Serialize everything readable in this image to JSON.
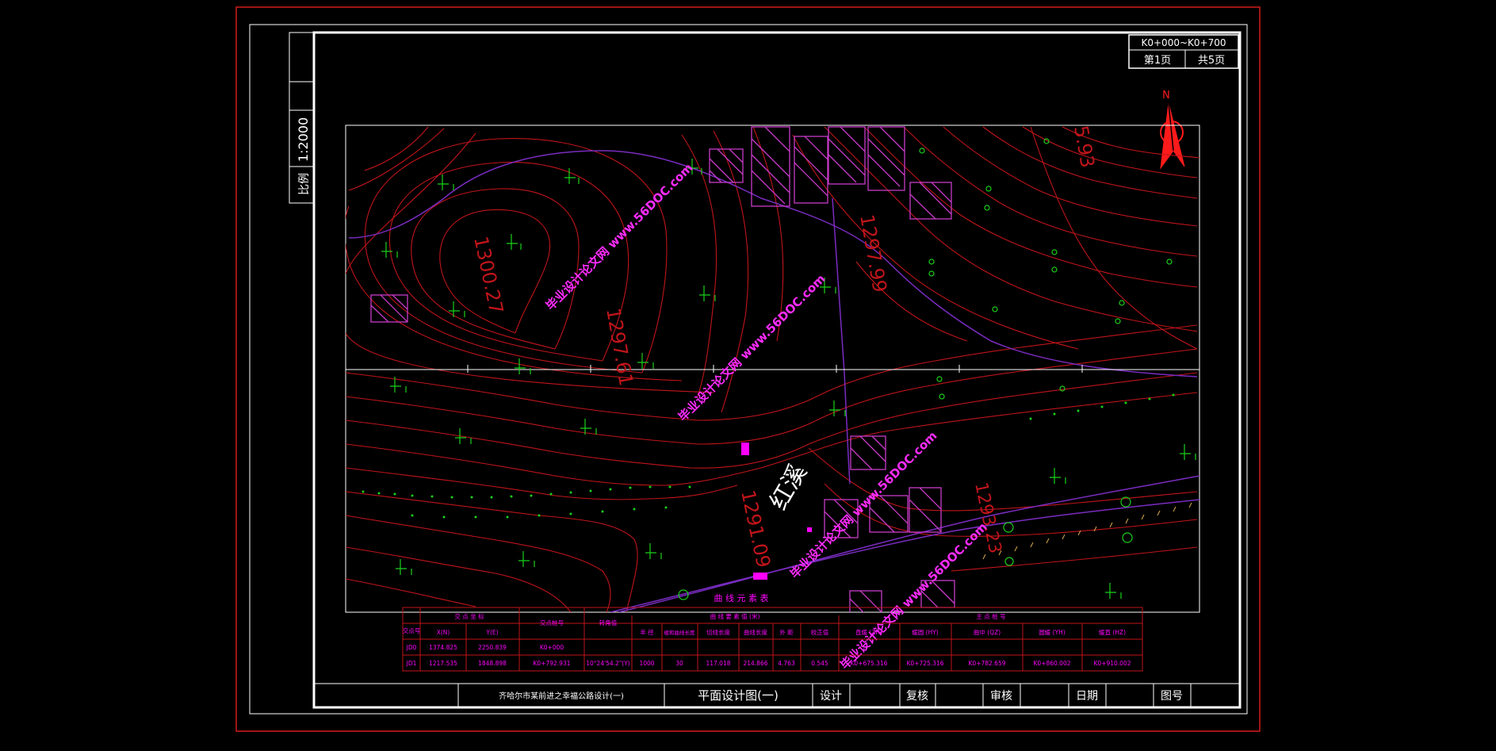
{
  "title_block": {
    "project_title": "齐哈尔市某前进之幸福公路设计(一)",
    "sheet_title": "平面设计图(一)",
    "design_label": "设计",
    "review_label": "复核",
    "approve_label": "审核",
    "date_label": "日期",
    "drawing_no_label": "图号"
  },
  "scale": {
    "label": "比例",
    "value": "1:2000"
  },
  "page_box": {
    "range": "K0+000~K0+700",
    "page": "第1页",
    "total": "共5页"
  },
  "north_label": "N",
  "map_labels": {
    "river": "红溪",
    "elev_1": "1300.27",
    "elev_2": "1297.61",
    "elev_3": "1297.99",
    "elev_4": "1291.09",
    "elev_5": "1293.23",
    "elev_6": "5.93",
    "table_caption": "曲 线 元 素 表"
  },
  "watermarks": [
    "毕业设计论文网 www.56DOC.com",
    "毕业设计论文网 www.56DOC.com",
    "毕业设计论文网 www.56DOC.com",
    "毕业设计论文网 www.56DOC.com"
  ],
  "curve_table": {
    "h_jd": "交点号",
    "h_coord": "交 点 坐 标",
    "h_x": "X(N)",
    "h_y": "Y(E)",
    "h_station": "交点桩号",
    "h_angle": "转角值",
    "h_elements": "曲 线 要 素 值 (米)",
    "h_r": "半 径",
    "h_ls": "缓和曲线长度",
    "h_t": "切线长度",
    "h_l": "曲线长度",
    "h_e": "外 距",
    "h_d": "校正值",
    "h_points": "主 点 桩 号",
    "h_zh": "直缓 (ZH)",
    "h_hy": "缓圆 (HY)",
    "h_qz": "曲中 (QZ)",
    "h_yh": "圆缓 (YH)",
    "h_hz": "缓直 (HZ)",
    "rows": [
      {
        "jd": "JD0",
        "x": "1374.825",
        "y": "2250.839",
        "station": "K0+000",
        "angle": "",
        "r": "",
        "ls": "",
        "t": "",
        "l": "",
        "e": "",
        "d": "",
        "zh": "",
        "hy": "",
        "qz": "",
        "yh": "",
        "hz": ""
      },
      {
        "jd": "JD1",
        "x": "1217.535",
        "y": "1848.898",
        "station": "K0+792.931",
        "angle": "10°24'54.2\"(Y)",
        "r": "1000",
        "ls": "30",
        "t": "117.018",
        "l": "214.866",
        "e": "4.763",
        "d": "0.545",
        "zh": "K0+675.316",
        "hy": "K0+725.316",
        "qz": "K0+782.659",
        "yh": "K0+860.002",
        "hz": "K0+910.002"
      }
    ]
  },
  "colors": {
    "contour": "#c0151a",
    "frame": "#ffffff",
    "accent": "#ff00ff",
    "symbol": "#1bd11b",
    "outer": "#d21a1a",
    "road": "#7a2cc0",
    "north": "#ff1a1a"
  }
}
